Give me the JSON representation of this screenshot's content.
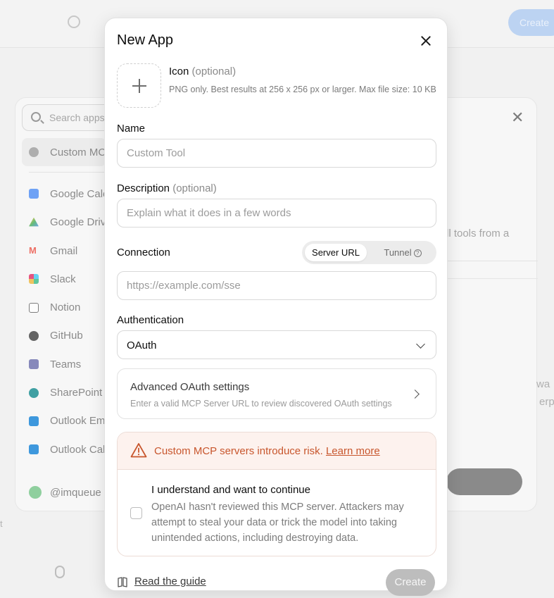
{
  "background": {
    "top_create_label": "Create",
    "search_placeholder": "Search apps",
    "list_items": [
      {
        "label": "Custom MCP",
        "icon": "custom-mcp-icon",
        "color": "#9a9a9a"
      },
      {
        "label": "Google Calendar",
        "icon": "google-calendar-icon",
        "color": "#4285f4"
      },
      {
        "label": "Google Drive",
        "icon": "google-drive-icon",
        "color": "#34a853"
      },
      {
        "label": "Gmail",
        "icon": "gmail-icon",
        "color": "#ea4335"
      },
      {
        "label": "Slack",
        "icon": "slack-icon",
        "color": "#e01e5a"
      },
      {
        "label": "Notion",
        "icon": "notion-icon",
        "color": "#555555"
      },
      {
        "label": "GitHub",
        "icon": "github-icon",
        "color": "#333333"
      },
      {
        "label": "Teams",
        "icon": "teams-icon",
        "color": "#6264a7"
      },
      {
        "label": "SharePoint",
        "icon": "sharepoint-icon",
        "color": "#038387"
      },
      {
        "label": "Outlook Email",
        "icon": "outlook-email-icon",
        "color": "#0078d4"
      },
      {
        "label": "Outlook Calendar",
        "icon": "outlook-calendar-icon",
        "color": "#0078d4"
      }
    ],
    "user_label": "@imqueue",
    "right_fragment": "ll tools from a",
    "right_frag_1": "wa",
    "right_frag_2": "erp",
    "left_frag": "t"
  },
  "modal": {
    "title": "New App",
    "icon_section": {
      "label": "Icon",
      "optional": "(optional)",
      "hint": "PNG only. Best results at 256 x 256 px or larger. Max file size: 10 KB"
    },
    "name": {
      "label": "Name",
      "placeholder": "Custom Tool"
    },
    "description": {
      "label": "Description",
      "optional": "(optional)",
      "placeholder": "Explain what it does in a few words"
    },
    "connection": {
      "label": "Connection",
      "options": [
        "Server URL",
        "Tunnel"
      ],
      "selected": "Server URL",
      "url_placeholder": "https://example.com/sse"
    },
    "authentication": {
      "label": "Authentication",
      "value": "OAuth"
    },
    "advanced": {
      "title": "Advanced OAuth settings",
      "subtitle": "Enter a valid MCP Server URL to review discovered OAuth settings"
    },
    "risk": {
      "warning": "Custom MCP servers introduce risk.",
      "link": "Learn more",
      "consent_title": "I understand and want to continue",
      "consent_body": "OpenAI hasn't reviewed this MCP server. Attackers may attempt to steal your data or trick the model into taking unintended actions, including destroying data.",
      "checked": false
    },
    "footer": {
      "guide_label": "Read the guide",
      "create_label": "Create"
    },
    "colors": {
      "warning": "#c8562d",
      "warning_bg": "#fdf2ee",
      "disabled_button": "#bdbdbd"
    }
  }
}
